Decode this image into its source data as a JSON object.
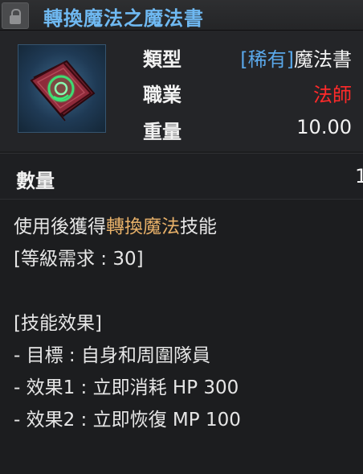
{
  "header": {
    "title": "轉換魔法之魔法書"
  },
  "item": {
    "icon": "green-rune-spellbook-icon",
    "type_label": "類型",
    "type_rarity": "[稀有]",
    "type_value": "魔法書",
    "class_label": "職業",
    "class_value": "法師",
    "weight_label": "重量",
    "weight_value": "10.00"
  },
  "quantity": {
    "label": "數量",
    "value": "1"
  },
  "description": {
    "line1_prefix": "使用後獲得",
    "line1_highlight": "轉換魔法",
    "line1_suffix": "技能",
    "requirement": "[等級需求 : 30]",
    "effects_header": "[技能效果]",
    "target": " - 目標 : 自身和周圍隊員",
    "effect1": " - 效果1 : 立即消耗 HP 300",
    "effect2": " - 效果2 : 立即恢復 MP 100"
  },
  "colors": {
    "title": "#6fb9f2",
    "rarity": "#5aa8ea",
    "class": "#ff2a2a",
    "highlight": "#e8b169"
  }
}
